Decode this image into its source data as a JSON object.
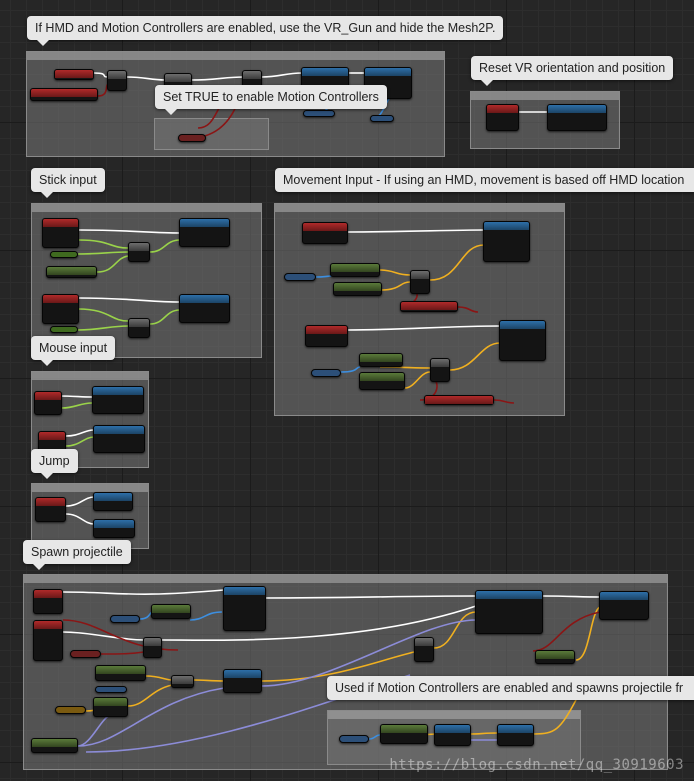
{
  "comments": {
    "hmd": "If HMD and Motion Controllers are enabled, use the VR_Gun and hide the Mesh2P.",
    "set_true": "Set TRUE to enable Motion Controllers",
    "reset_vr": "Reset VR orientation and position",
    "stick": "Stick input",
    "movement": "Movement Input - If using an HMD, movement is based off HMD location",
    "mouse": "Mouse input",
    "jump": "Jump",
    "spawn": "Spawn projectile",
    "used_if": "Used if Motion Controllers are enabled and spawns projectile fr"
  },
  "watermark": "https://blog.csdn.net/qq_30919603",
  "colors": {
    "exec_wire": "#ffffff",
    "float_wire": "#9ad34a",
    "vector_wire": "#f0b020",
    "object_wire": "#3d8fe0",
    "bool_wire": "#8a1515",
    "struct_wire": "#8c8cd8",
    "event_header": "#b02a2a",
    "function_header": "#2d6fa8",
    "pure_header": "#5a7a3a"
  }
}
